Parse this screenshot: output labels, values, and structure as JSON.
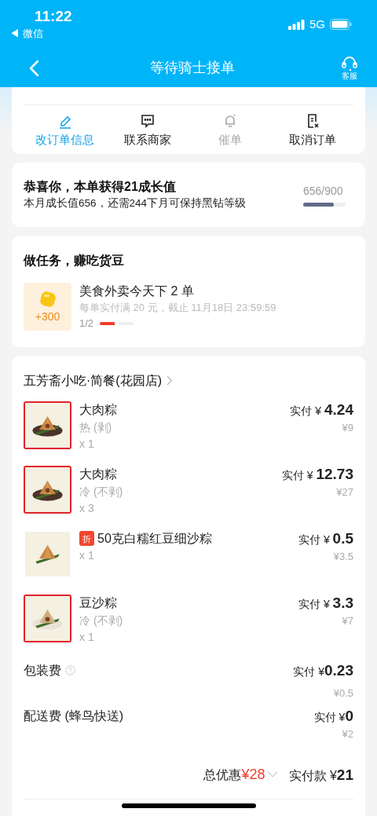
{
  "status_bar": {
    "time": "11:22",
    "back_app": "◀ 微信",
    "network": "5G"
  },
  "nav": {
    "title": "等待骑士接单",
    "service_label": "客服"
  },
  "actions": [
    {
      "label": "改订单信息",
      "selected": true,
      "disabled": false
    },
    {
      "label": "联系商家",
      "selected": false,
      "disabled": false
    },
    {
      "label": "催单",
      "selected": false,
      "disabled": true
    },
    {
      "label": "取消订单",
      "selected": false,
      "disabled": false
    }
  ],
  "growth": {
    "title": "恭喜你，本单获得21成长值",
    "subtitle": "本月成长值656，还需244下月可保持黑钻等级",
    "reading": "656/900",
    "level": 0.73
  },
  "task": {
    "heading": "做任务，赚吃货豆",
    "reward": "+300",
    "title": "美食外卖今天下 2 单",
    "detail": "每单实付满 20 元，截止 11月18日 23:59:59",
    "progress": "1/2",
    "level": 0.5
  },
  "order": {
    "shop": "五芳斋小吃·简餐(花园店)",
    "items": [
      {
        "name": "大肉粽",
        "spec": "热 (剥)",
        "qty": "x 1",
        "paid_label": "实付 ¥ ",
        "paid": "4.24",
        "original": "¥9",
        "outlined": true
      },
      {
        "name": "大肉粽",
        "spec": "冷 (不剥)",
        "qty": "x 3",
        "paid_label": "实付 ¥ ",
        "paid": "12.73",
        "original": "¥27",
        "outlined": true
      },
      {
        "name": "50克白糯红豆细沙粽",
        "badge": "折",
        "qty": "x 1",
        "paid_label": "实付 ¥ ",
        "paid": "0.5",
        "original": "¥3.5",
        "outlined": false
      },
      {
        "name": "豆沙粽",
        "spec": "冷 (不剥)",
        "qty": "x 1",
        "paid_label": "实付 ¥ ",
        "paid": "3.3",
        "original": "¥7",
        "outlined": true
      }
    ],
    "fees": [
      {
        "label": "包装费",
        "help": true,
        "paid_label": "实付 ¥",
        "paid": "0.23",
        "original": "¥0.5"
      },
      {
        "label": "配送费 (蜂鸟快送)",
        "paid_label": "实付 ¥",
        "paid": "0",
        "original": "¥2"
      }
    ],
    "discount_label": "总优惠",
    "discount": "¥28",
    "total_label": "实付款 ¥",
    "total": "21"
  }
}
